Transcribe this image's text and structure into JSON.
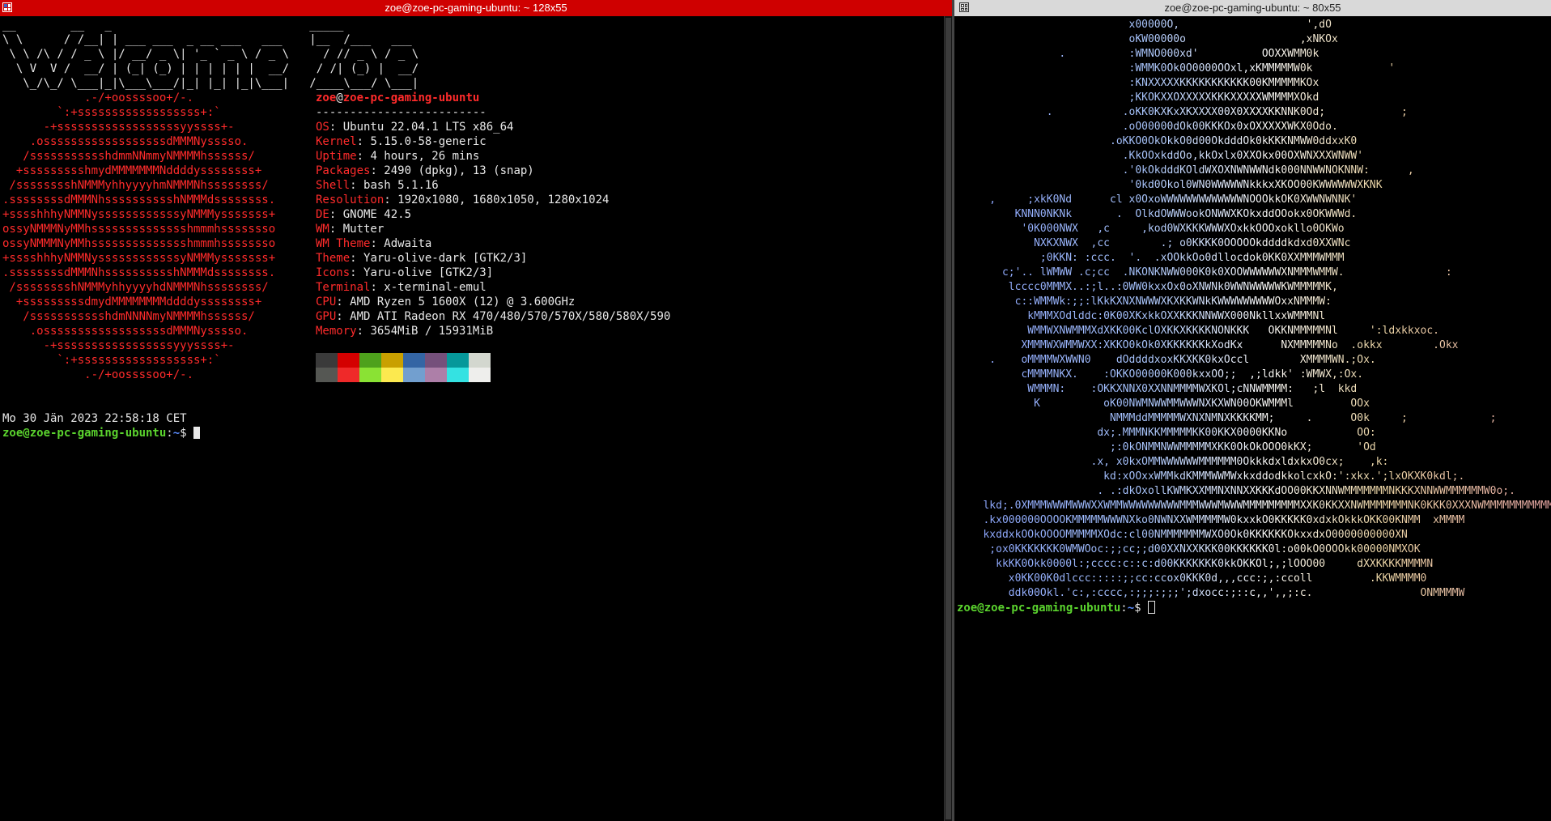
{
  "colors": {
    "accent_red": "#ff2b2b",
    "prompt_green": "#5bd42e",
    "prompt_blue": "#5b8cff",
    "text": "#e8e8e8",
    "titlebar_active": "#cf0000",
    "titlebar_inactive": "#d9d9d9"
  },
  "left_window": {
    "title": "zoe@zoe-pc-gaming-ubuntu: ~ 128x55",
    "icon": "terminal-window-icon",
    "ascii_header": "__        __   _                             _____              \n\\ \\      / /__| | ___ ___  _ __ ___   ___    |__  /___   ___    \n \\ \\ /\\ / / _ \\ |/ __/ _ \\| '_ ` _ \\ / _ \\     / // _ \\ / _ \\   \n  \\ V  V /  __/ | (_| (_) | | | | | |  __/    / /| (_) |  __/   \n   \\_/\\_/ \\___|_|\\___\\___/|_| |_| |_|\\___|   /____\\___/ \\___|   ",
    "distro_logo": "            .-/+oossssoo+/-.\n        `:+ssssssssssssssssss+:`\n      -+ssssssssssssssssssyyssss+-\n    .ossssssssssssssssssdMMMNysssso.\n   /ssssssssssshdmmNNmmyNMMMMhssssss/\n  +ssssssssshmydMMMMMMMNddddyssssssss+\n /sssssssshNMMMyhhyyyyhmNMMMNhssssssss/\n.ssssssssdMMMNhsssssssssshNMMMdssssssss.\n+sssshhhyNMMNyssssssssssssyNMMMysssssss+\nossyNMMMNyMMhsssssssssssssshmmmhssssssso\nossyNMMMNyMMhsssssssssssssshmmmhssssssso\n+sssshhhyNMMNyssssssssssssyNMMMysssssss+\n.ssssssssdMMMNhsssssssssshNMMMdssssssss.\n /sssssssshNMMMyhhyyyyhdNMMMNhssssssss/\n  +sssssssssdmydMMMMMMMMddddyssssssss+\n   /ssssssssssshdmNNNNmyNMMMMhssssss/\n    .ossssssssssssssssssdMMMNysssso.\n      -+sssssssssssssssssyyyssss+-\n        `:+ssssssssssssssssss+:`\n            .-/+oossssoo+/-.",
    "info": {
      "user": "zoe",
      "at": "@",
      "host": "zoe-pc-gaming-ubuntu",
      "separator": "-------------------------",
      "rows": [
        {
          "key": "OS",
          "value": "Ubuntu 22.04.1 LTS x86_64"
        },
        {
          "key": "Kernel",
          "value": "5.15.0-58-generic"
        },
        {
          "key": "Uptime",
          "value": "4 hours, 26 mins"
        },
        {
          "key": "Packages",
          "value": "2490 (dpkg), 13 (snap)"
        },
        {
          "key": "Shell",
          "value": "bash 5.1.16"
        },
        {
          "key": "Resolution",
          "value": "1920x1080, 1680x1050, 1280x1024"
        },
        {
          "key": "DE",
          "value": "GNOME 42.5"
        },
        {
          "key": "WM",
          "value": "Mutter"
        },
        {
          "key": "WM Theme",
          "value": "Adwaita"
        },
        {
          "key": "Theme",
          "value": "Yaru-olive-dark [GTK2/3]"
        },
        {
          "key": "Icons",
          "value": "Yaru-olive [GTK2/3]"
        },
        {
          "key": "Terminal",
          "value": "x-terminal-emul"
        },
        {
          "key": "CPU",
          "value": "AMD Ryzen 5 1600X (12) @ 3.600GHz"
        },
        {
          "key": "GPU",
          "value": "AMD ATI Radeon RX 470/480/570/570X/580/580X/590"
        },
        {
          "key": "Memory",
          "value": "3654MiB / 15931MiB"
        }
      ]
    },
    "palette": [
      "#3a3a3a",
      "#d40000",
      "#4ea11c",
      "#c9a000",
      "#3465a4",
      "#75507b",
      "#06989a",
      "#d3d7cf",
      "#555753",
      "#ef2929",
      "#8ae234",
      "#fce94f",
      "#729fcf",
      "#ad7fa8",
      "#34e2e2",
      "#eeeeec"
    ],
    "date_line": "Mo 30 Jän 2023 22:58:18 CET",
    "prompt": {
      "userhost": "zoe@zoe-pc-gaming-ubuntu",
      "path": "~",
      "symbol": "$ "
    }
  },
  "right_window": {
    "title": "zoe@zoe-pc-gaming-ubuntu: ~ 80x55",
    "icon": "terminal-window-icon",
    "art": "                          x00000O,                    ',dO\n                          oKW00000o                  ,xNKOx\n               .          :WMNO000xd'          OOXXWMM0k\n                          :WMMK0Ok0O0000OOxl,xKMMMMMW0k            '\n                          :KNXXXXXKKKKKKKKKKK00KMMMMMKOx\n                          ;KKOKXXOXXXXXKKKXXXXXWMMMMXOkd\n             .           .oKK0KXKxXKXXXX00X0XXXXKKNNK0Od;            ;\n                         .oO00000dOk00KKKOx0xOXXXXXWKX0Odo.\n                       .oKKO0OkOkkO0d00OkdddOk0kKKKNMWW0ddxxK0\n                         .KkOOxkddOo,kkOxlx0XXOkx00OXWNXXXWNWW'\n                         .'0kOkdddKOldWXOXNWNWWNdk000NNWWNOKNNW:      ,\n                          '0kd0Okol0WN0WWWWWNkkkxXKOO00KWWWWWWXKNK\n    ,     ;xkK0Nd      cl x0OxoWWWWWWWWWWWWWNOOOkkOK0XWWNWNNK'\n        KNNN0NKNk       .  OlkdOWWWookONWWXKOkxddOOokx0OKWWWd.\n         '0K000NWX   ,c     ,kod0WXKKKWWWXOxkkOOOxokllo0OKWo\n           NXKXNWX  ,cc        .; o0KKKK0OOOOOkddddkdxd0XXWNc\n            ;0KKN: :ccc.  '.  .xOOkkOo0dllocdok0KK0XXMMMWMMM\n      c;'.. lWMWW .c;cc  .NKONKNWW000K0k0XOOWWWWWWXNMMMWMMW.                :\n       lcccc0MMMX..:;l..:0WW0kxxOx0oXNWNk0WWNWWWWWKWMMMMMK,\n        c::WMMWk:;;:lKkKXNXNWWWXKXKKWNkKWWWWWWWWWOxxNMMMW:\n          kMMMXOdlddc:0K00XKxkkOXXKKKNNWWX000NkllxxWMMMNl\n          WMMWXNWMMMXdXKK00KclOXKKXKKKKNONKKK   OKKNMMMMMNl     ':ldxkkxoc.\n         XMMMWXWMMWXX:XKKO0kOk0XKKKKKKkXodKx      NXMMMMMNo  .okkx        .Okx\n    .    oMMMMWXWWN0    dOddddxoxKKXKK0kxOccl        XMMMMWN.;Ox.\n         cMMMMNKX.    :OKKO00000K000kxxOO;;  ,;ldkk' :WMWX,:Ox.\n          WMMMN:    :OKKXNNX0XXNNMMMMWXKOl;cNNWMMMM:   ;l  kkd\n           K          oK00NWMNWWMMWWWNXKXWN00OKWMMMl         OOx\n                       NMMMddMMMMMWXNXNMNXKKKKMM;     .      O0k     ;             ;\n                     dx;.MMMNKKMMMMMKK00KKX0000KKNo           OO:\n                       ;:0kONMMNWWMMMMMXKK0OkOkOOO0kKX;       'Od\n                    .x, x0kxOMMWWWWWWMMMMMM0OkkkdxldxkxO0cx;    ,k:\n                      kd:xOOxxWMMkdKMMMWWMWxkxddodkkolcxkO:':xkx.';lxOKXK0kdl;.\n                     . .:dkOxollKWMKXXMMNXNNXXKKKdOO00KKXNNWMMMMMMMNKKKXNNWWMMMMMMW0o;.\n   lkd;.0XMMMWWWMWWWXXWMMWWWWWWWWWMMMWWWMWWWMMMMMMMMMXXK0KKXXNWMMMMMMMNK0KKK0XXXNWMMMMMMMMMMMX\n   .kx000000OOOOKMMMMMWWWNXko0NWNXXWMMMMMW0kxxkO0KKKKK0xdxkOkkkOKK00KNMM  xMMMM\n   kxddxkOOkOOOOMMMMMXOdc:cl00NMMMMMMMWXO0Ok0KKKKKKOkxxdxO0000000000XN\n    ;ox0KKKKKKK0WMWOoc:;;cc;;d00XXNXXKKK00KKKKKK0l:o00kO0OOOkk00000NMXOK\n     kkKK0Okk0000l:;cccc:c::c:d00KKKKKKK0kkOKKOl;,;lOOO00     dXXKKKKMMMMN\n       x0KK00K0dlccc:::::;;cc:ccox0KKK0d,,,ccc:;,:ccoll         .KKWMMMM0\n       ddk00Okl.'c:,:cccc,:;;;:;;;';dxocc:;::c,,',,;:c.                 ONMMMMW",
    "prompt": {
      "userhost": "zoe@zoe-pc-gaming-ubuntu",
      "path": "~",
      "symbol": "$ "
    }
  }
}
